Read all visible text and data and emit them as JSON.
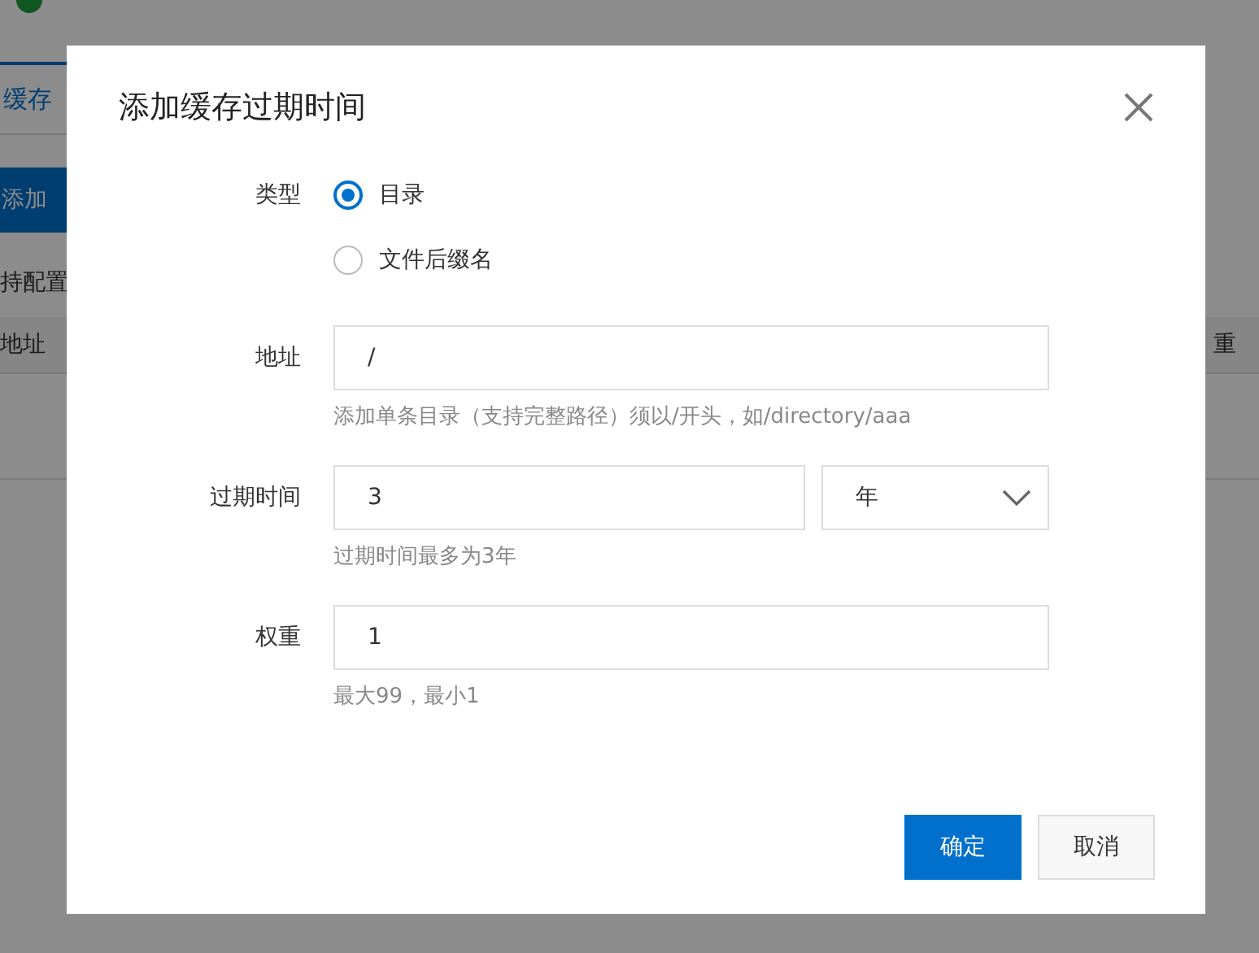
{
  "background": {
    "tab": "缓存",
    "add_button": "添加",
    "section_label": "持配置",
    "table_columns": [
      "地址",
      "重"
    ]
  },
  "dialog": {
    "title": "添加缓存过期时间",
    "fields": [
      {
        "kind": "radio",
        "label": "类型",
        "options": [
          {
            "label": "目录",
            "selected": true
          },
          {
            "label": "文件后缀名",
            "selected": false
          }
        ]
      },
      {
        "kind": "input",
        "label": "地址",
        "value": "/",
        "help": "添加单条目录（支持完整路径）须以/开头，如/directory/aaa"
      },
      {
        "kind": "input_select",
        "label": "过期时间",
        "value": "3",
        "select": "年",
        "help": "过期时间最多为3年"
      },
      {
        "kind": "input",
        "label": "权重",
        "value": "1",
        "help": "最大99，最小1"
      }
    ],
    "buttons": [
      {
        "label": "确定",
        "kind": "primary"
      },
      {
        "label": "取消",
        "kind": "secondary"
      }
    ]
  }
}
